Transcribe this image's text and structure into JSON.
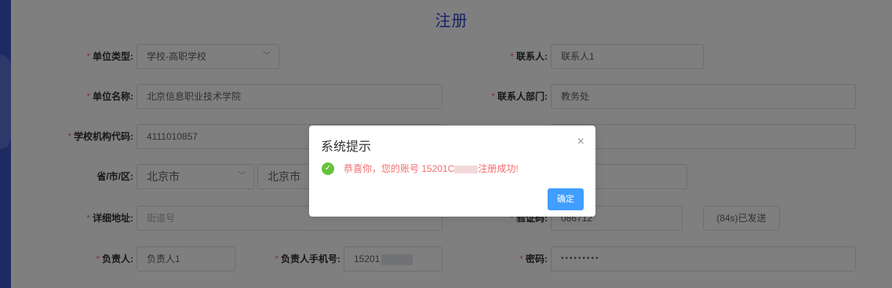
{
  "page": {
    "title": "注册"
  },
  "form": {
    "unit_type": {
      "label": "单位类型:",
      "value": "学校-高职学校"
    },
    "unit_name": {
      "label": "单位名称:",
      "value": "北京信息职业技术学院"
    },
    "school_code": {
      "label": "学校机构代码:",
      "value": "4111010857"
    },
    "region": {
      "label": "省/市/区:",
      "province": "北京市",
      "city": "北京市"
    },
    "address": {
      "label": "详细地址:",
      "placeholder": "街道号"
    },
    "principal": {
      "label": "负责人:",
      "value": "负责人1"
    },
    "principal_phone": {
      "label": "负责人手机号:",
      "value": "15201"
    },
    "contact": {
      "label": "联系人:",
      "value": "联系人1"
    },
    "contact_dept": {
      "label": "联系人部门:",
      "value": "教务处"
    },
    "verify_code": {
      "label": "验证码:",
      "value": "086712",
      "button": "(84s)已发送"
    },
    "password": {
      "label": "密码:",
      "value": "•••••••••"
    }
  },
  "dialog": {
    "title": "系统提示",
    "close_icon": "×",
    "message_prefix": "恭喜你，您的账号 15201C",
    "message_suffix": "注册成功!",
    "confirm_label": "确定",
    "success_icon": "✓"
  },
  "icons": {
    "chevron": "﹀"
  },
  "colors": {
    "accent": "#2e3fd1",
    "primary_button": "#409eff",
    "success": "#67c23a",
    "error_text": "#f56c6c",
    "sidebar": "#3d57c7"
  }
}
